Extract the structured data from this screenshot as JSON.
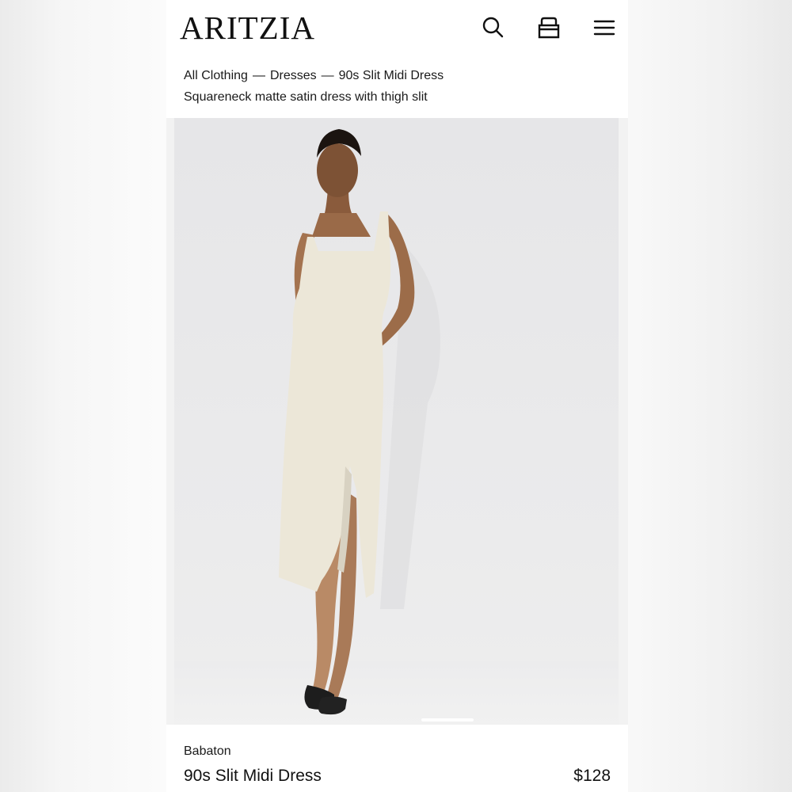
{
  "header": {
    "logo": "ARITZIA",
    "search_icon": "search-icon",
    "bag_icon": "shopping-bag-icon",
    "menu_icon": "hamburger-menu-icon"
  },
  "breadcrumb": {
    "items": [
      "All Clothing",
      "Dresses",
      "90s Slit Midi Dress"
    ],
    "separator": "—"
  },
  "product": {
    "description": "Squareneck matte satin dress with thigh slit",
    "brand": "Babaton",
    "name": "90s Slit Midi Dress",
    "price": "$128",
    "image_pager": {
      "current": 1
    }
  },
  "colors": {
    "text": "#111111",
    "background": "#ffffff",
    "dress": "#ece7d8"
  }
}
